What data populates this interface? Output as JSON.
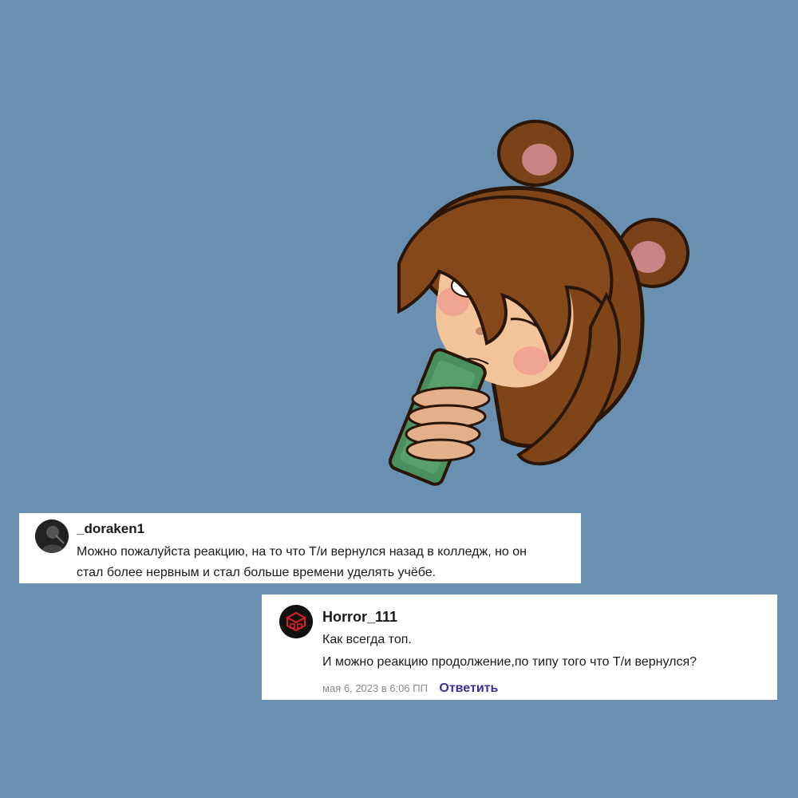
{
  "colors": {
    "background": "#6990b0",
    "card": "#ffffff",
    "text": "#1a1a1a",
    "timestamp": "#8a8a8a",
    "reply_link": "#3b2e9e"
  },
  "illustration": {
    "icon": "bear-eared-character-holding-phone"
  },
  "comments": [
    {
      "avatar_icon": "user-photo-avatar",
      "username": "_doraken1",
      "lines": [
        "Можно пожалуйста реакцию, на то что Т/и вернулся назад в колледж, но он",
        "стал более нервным и стал больше времени уделять учёбе."
      ]
    },
    {
      "avatar_icon": "red-geometric-logo-avatar",
      "username": "Horror_111",
      "lines": [
        "Как всегда топ.",
        "И можно реакцию продолжение,по типу того что Т/и вернулся?"
      ],
      "timestamp": "мая 6, 2023 в 6:06 ПП",
      "reply_label": "Ответить"
    }
  ]
}
